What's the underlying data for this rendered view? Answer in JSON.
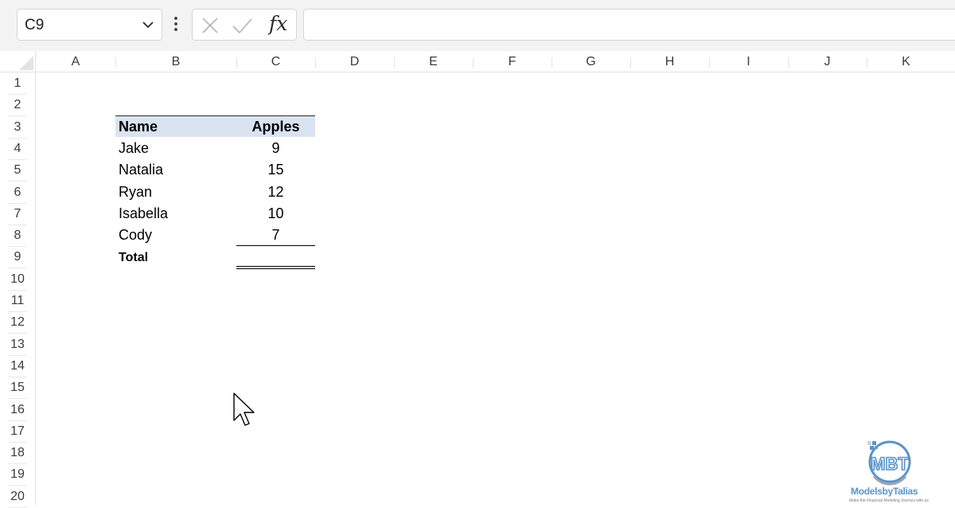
{
  "formula_bar": {
    "name_box": "C9",
    "fx_label": "fx",
    "formula": ""
  },
  "columns": [
    "A",
    "B",
    "C",
    "D",
    "E",
    "F",
    "G",
    "H",
    "I",
    "J",
    "K"
  ],
  "rows": [
    "1",
    "2",
    "3",
    "4",
    "5",
    "6",
    "7",
    "8",
    "9",
    "10",
    "11",
    "12",
    "13",
    "14",
    "15",
    "16",
    "17",
    "18",
    "19",
    "20"
  ],
  "table": {
    "header_name": "Name",
    "header_apples": "Apples",
    "rows": [
      {
        "name": "Jake",
        "apples": "9"
      },
      {
        "name": "Natalia",
        "apples": "15"
      },
      {
        "name": "Ryan",
        "apples": "12"
      },
      {
        "name": "Isabella",
        "apples": "10"
      },
      {
        "name": "Cody",
        "apples": "7"
      }
    ],
    "total_label": "Total"
  },
  "icons": {
    "cancel": "close-icon",
    "enter": "checkmark-icon",
    "name_dropdown": "chevron-down-icon",
    "more": "vertical-dots-icon"
  },
  "colors": {
    "header_fill": "#dae3f1",
    "logo": "#5b93c8"
  },
  "watermark": {
    "logo_letters": "MBT",
    "brand": "ModelsbyTalias",
    "tagline": "Make the Financial Modeling Journey with us"
  }
}
